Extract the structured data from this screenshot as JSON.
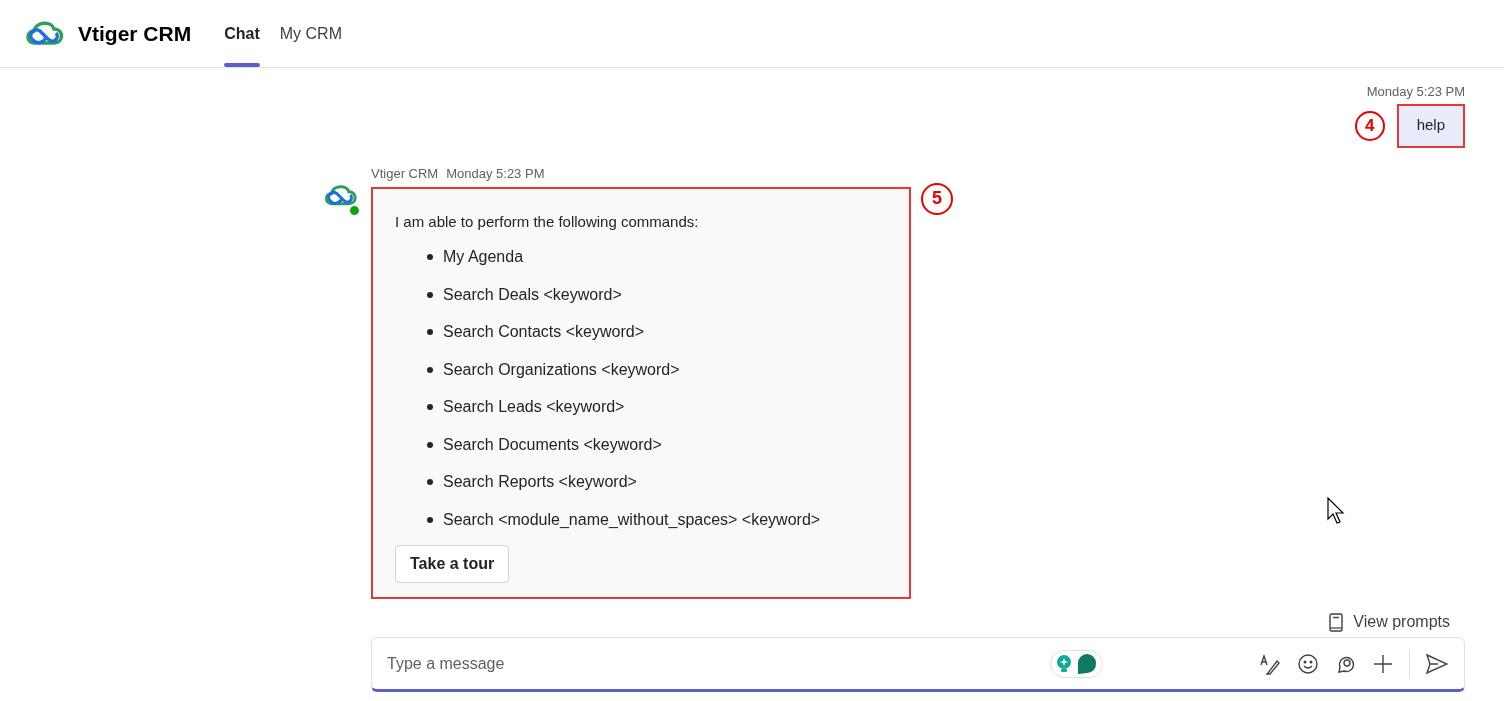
{
  "app": {
    "title": "Vtiger CRM"
  },
  "tabs": [
    {
      "label": "Chat",
      "selected": true
    },
    {
      "label": "My CRM",
      "selected": false
    }
  ],
  "user_message": {
    "time": "Monday 5:23 PM",
    "text": "help",
    "callout": "4"
  },
  "bot_message": {
    "sender": "Vtiger CRM",
    "time": "Monday 5:23 PM",
    "online": true,
    "callout": "5",
    "intro": "I am able to perform the following commands:",
    "commands": [
      "My Agenda",
      "Search Deals <keyword>",
      "Search Contacts <keyword>",
      "Search Organizations <keyword>",
      "Search Leads <keyword>",
      "Search Documents <keyword>",
      "Search Reports <keyword>",
      "Search <module_name_without_spaces> <keyword>"
    ],
    "button": "Take a tour"
  },
  "view_prompts": "View prompts",
  "composer": {
    "placeholder": "Type a message"
  }
}
